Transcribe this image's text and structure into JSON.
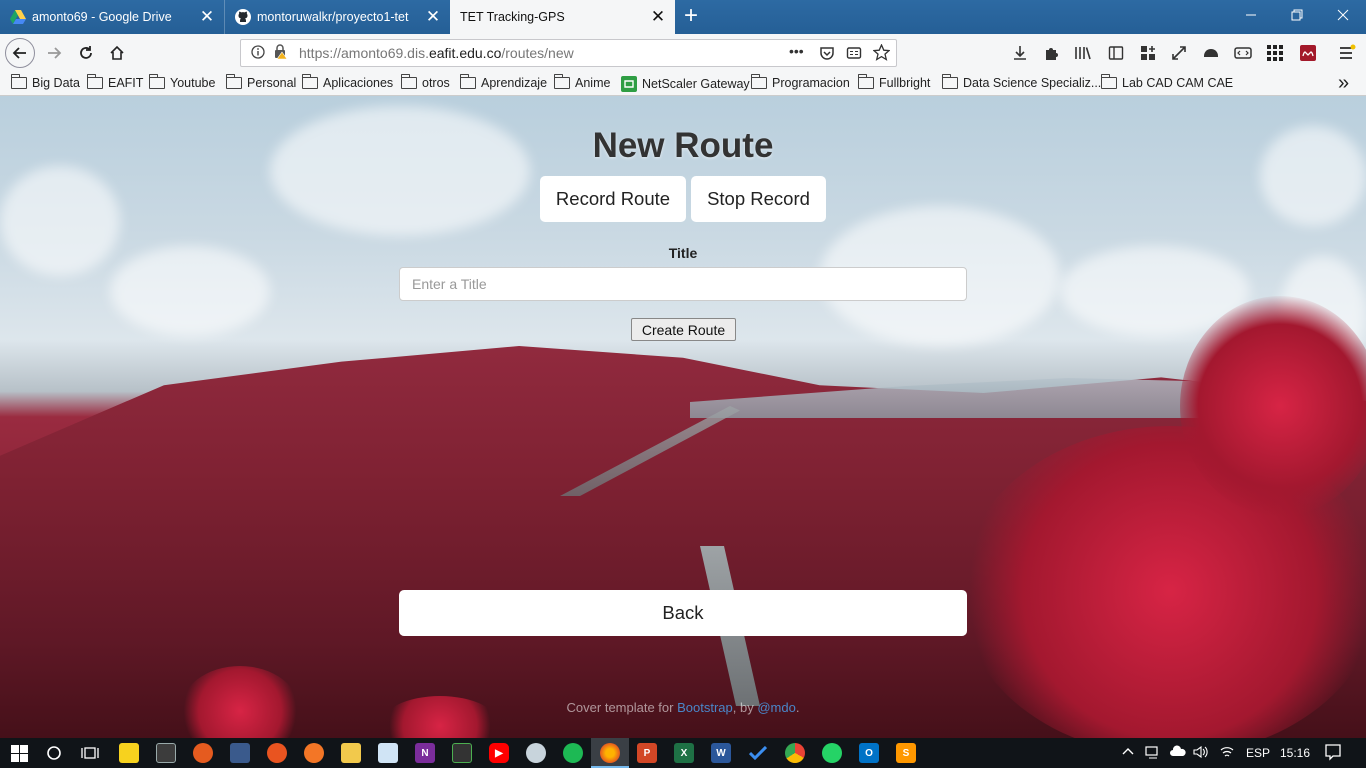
{
  "browser": {
    "tabs": [
      {
        "label": "amonto69 - Google Drive",
        "icon": "google-drive-icon",
        "active": false
      },
      {
        "label": "montoruwalkr/proyecto1-tet",
        "icon": "github-icon",
        "active": false
      },
      {
        "label": "TET Tracking-GPS",
        "icon": "",
        "active": true
      }
    ],
    "close_glyph": "✕",
    "new_tab_glyph": "+",
    "url": {
      "prefix": "https://amonto69.dis.",
      "host": "eafit.edu.co",
      "path": "/routes/new"
    },
    "url_overflow_glyph": "•••",
    "bookmarks": [
      "Big Data",
      "EAFIT",
      "Youtube",
      "Personal",
      "Aplicaciones",
      "otros",
      "Aprendizaje",
      "Anime",
      "NetScaler Gateway",
      "Programacion",
      "Fullbright",
      "Data Science Specializ...",
      "Lab CAD CAM CAE"
    ],
    "bookmarks_overflow": "»"
  },
  "page": {
    "heading": "New Route",
    "record_button": "Record Route",
    "stop_button": "Stop Record",
    "title_label": "Title",
    "title_placeholder": "Enter a Title",
    "create_button": "Create Route",
    "back_button": "Back",
    "footer": {
      "prefix": "Cover template for ",
      "link1": "Bootstrap",
      "middle": ", by ",
      "link2": "@mdo",
      "suffix": "."
    }
  },
  "taskbar": {
    "language": "ESP",
    "time": "15:16"
  },
  "colors": {
    "tabbar": "#2d6aa3",
    "link": "#4a86c8",
    "taskbar": "#101418"
  }
}
